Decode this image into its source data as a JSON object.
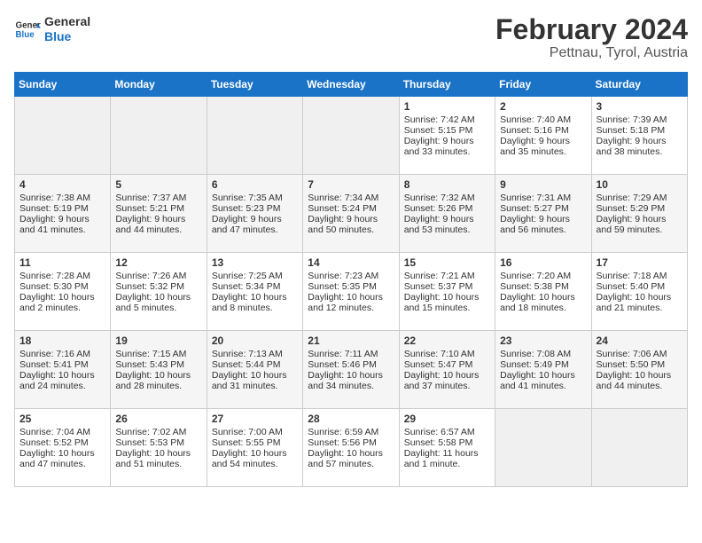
{
  "header": {
    "logo_line1": "General",
    "logo_line2": "Blue",
    "month": "February 2024",
    "location": "Pettnau, Tyrol, Austria"
  },
  "weekdays": [
    "Sunday",
    "Monday",
    "Tuesday",
    "Wednesday",
    "Thursday",
    "Friday",
    "Saturday"
  ],
  "weeks": [
    [
      {
        "day": "",
        "content": ""
      },
      {
        "day": "",
        "content": ""
      },
      {
        "day": "",
        "content": ""
      },
      {
        "day": "",
        "content": ""
      },
      {
        "day": "1",
        "content": "Sunrise: 7:42 AM\nSunset: 5:15 PM\nDaylight: 9 hours\nand 33 minutes."
      },
      {
        "day": "2",
        "content": "Sunrise: 7:40 AM\nSunset: 5:16 PM\nDaylight: 9 hours\nand 35 minutes."
      },
      {
        "day": "3",
        "content": "Sunrise: 7:39 AM\nSunset: 5:18 PM\nDaylight: 9 hours\nand 38 minutes."
      }
    ],
    [
      {
        "day": "4",
        "content": "Sunrise: 7:38 AM\nSunset: 5:19 PM\nDaylight: 9 hours\nand 41 minutes."
      },
      {
        "day": "5",
        "content": "Sunrise: 7:37 AM\nSunset: 5:21 PM\nDaylight: 9 hours\nand 44 minutes."
      },
      {
        "day": "6",
        "content": "Sunrise: 7:35 AM\nSunset: 5:23 PM\nDaylight: 9 hours\nand 47 minutes."
      },
      {
        "day": "7",
        "content": "Sunrise: 7:34 AM\nSunset: 5:24 PM\nDaylight: 9 hours\nand 50 minutes."
      },
      {
        "day": "8",
        "content": "Sunrise: 7:32 AM\nSunset: 5:26 PM\nDaylight: 9 hours\nand 53 minutes."
      },
      {
        "day": "9",
        "content": "Sunrise: 7:31 AM\nSunset: 5:27 PM\nDaylight: 9 hours\nand 56 minutes."
      },
      {
        "day": "10",
        "content": "Sunrise: 7:29 AM\nSunset: 5:29 PM\nDaylight: 9 hours\nand 59 minutes."
      }
    ],
    [
      {
        "day": "11",
        "content": "Sunrise: 7:28 AM\nSunset: 5:30 PM\nDaylight: 10 hours\nand 2 minutes."
      },
      {
        "day": "12",
        "content": "Sunrise: 7:26 AM\nSunset: 5:32 PM\nDaylight: 10 hours\nand 5 minutes."
      },
      {
        "day": "13",
        "content": "Sunrise: 7:25 AM\nSunset: 5:34 PM\nDaylight: 10 hours\nand 8 minutes."
      },
      {
        "day": "14",
        "content": "Sunrise: 7:23 AM\nSunset: 5:35 PM\nDaylight: 10 hours\nand 12 minutes."
      },
      {
        "day": "15",
        "content": "Sunrise: 7:21 AM\nSunset: 5:37 PM\nDaylight: 10 hours\nand 15 minutes."
      },
      {
        "day": "16",
        "content": "Sunrise: 7:20 AM\nSunset: 5:38 PM\nDaylight: 10 hours\nand 18 minutes."
      },
      {
        "day": "17",
        "content": "Sunrise: 7:18 AM\nSunset: 5:40 PM\nDaylight: 10 hours\nand 21 minutes."
      }
    ],
    [
      {
        "day": "18",
        "content": "Sunrise: 7:16 AM\nSunset: 5:41 PM\nDaylight: 10 hours\nand 24 minutes."
      },
      {
        "day": "19",
        "content": "Sunrise: 7:15 AM\nSunset: 5:43 PM\nDaylight: 10 hours\nand 28 minutes."
      },
      {
        "day": "20",
        "content": "Sunrise: 7:13 AM\nSunset: 5:44 PM\nDaylight: 10 hours\nand 31 minutes."
      },
      {
        "day": "21",
        "content": "Sunrise: 7:11 AM\nSunset: 5:46 PM\nDaylight: 10 hours\nand 34 minutes."
      },
      {
        "day": "22",
        "content": "Sunrise: 7:10 AM\nSunset: 5:47 PM\nDaylight: 10 hours\nand 37 minutes."
      },
      {
        "day": "23",
        "content": "Sunrise: 7:08 AM\nSunset: 5:49 PM\nDaylight: 10 hours\nand 41 minutes."
      },
      {
        "day": "24",
        "content": "Sunrise: 7:06 AM\nSunset: 5:50 PM\nDaylight: 10 hours\nand 44 minutes."
      }
    ],
    [
      {
        "day": "25",
        "content": "Sunrise: 7:04 AM\nSunset: 5:52 PM\nDaylight: 10 hours\nand 47 minutes."
      },
      {
        "day": "26",
        "content": "Sunrise: 7:02 AM\nSunset: 5:53 PM\nDaylight: 10 hours\nand 51 minutes."
      },
      {
        "day": "27",
        "content": "Sunrise: 7:00 AM\nSunset: 5:55 PM\nDaylight: 10 hours\nand 54 minutes."
      },
      {
        "day": "28",
        "content": "Sunrise: 6:59 AM\nSunset: 5:56 PM\nDaylight: 10 hours\nand 57 minutes."
      },
      {
        "day": "29",
        "content": "Sunrise: 6:57 AM\nSunset: 5:58 PM\nDaylight: 11 hours\nand 1 minute."
      },
      {
        "day": "",
        "content": ""
      },
      {
        "day": "",
        "content": ""
      }
    ]
  ]
}
